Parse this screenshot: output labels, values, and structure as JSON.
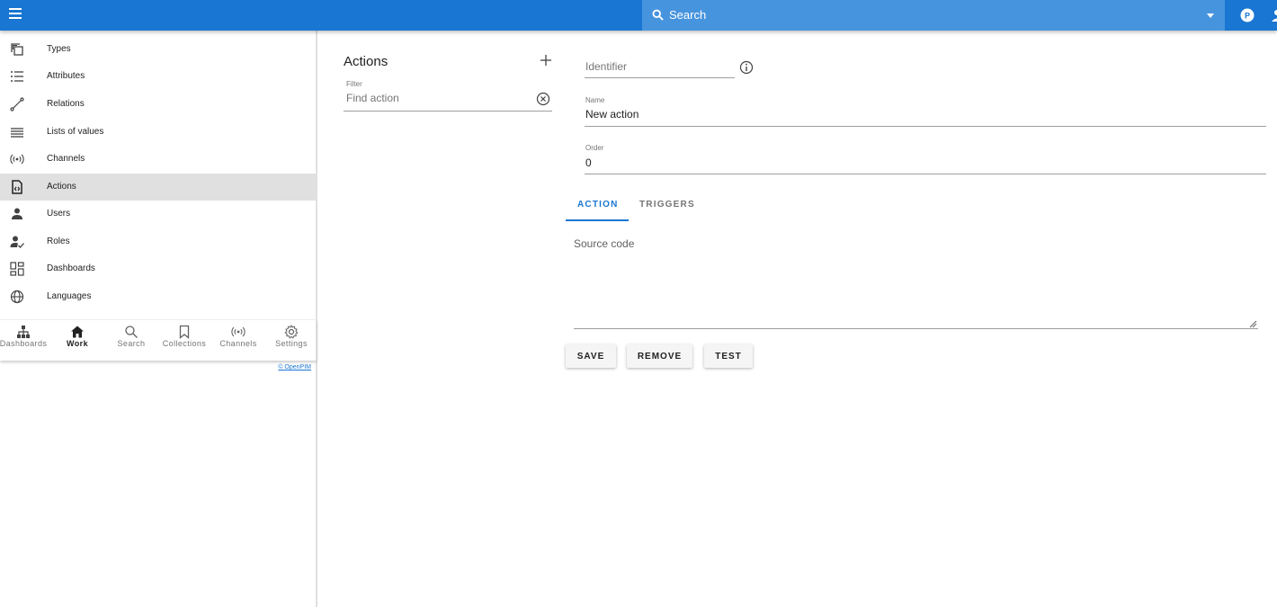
{
  "topbar": {
    "search_placeholder": "Search",
    "accent_color": "#1976d2"
  },
  "sidebar": {
    "items": [
      {
        "label": "Types",
        "icon": "types-icon"
      },
      {
        "label": "Attributes",
        "icon": "list-icon"
      },
      {
        "label": "Relations",
        "icon": "relations-icon"
      },
      {
        "label": "Lists of values",
        "icon": "lines-icon"
      },
      {
        "label": "Channels",
        "icon": "channels-icon"
      },
      {
        "label": "Actions",
        "icon": "code-file-icon",
        "active": true
      },
      {
        "label": "Users",
        "icon": "person-icon"
      },
      {
        "label": "Roles",
        "icon": "person-check-icon"
      },
      {
        "label": "Dashboards",
        "icon": "dashboard-icon"
      },
      {
        "label": "Languages",
        "icon": "globe-icon"
      }
    ],
    "bottom_nav": [
      {
        "label": "Dashboards",
        "icon": "sitemap-icon"
      },
      {
        "label": "Work",
        "icon": "home-icon",
        "active": true
      },
      {
        "label": "Search",
        "icon": "search-icon"
      },
      {
        "label": "Collections",
        "icon": "bookmark-icon"
      },
      {
        "label": "Channels",
        "icon": "channels-icon"
      },
      {
        "label": "Settings",
        "icon": "gear-icon"
      }
    ],
    "copyright": "© OpenPIM"
  },
  "list_panel": {
    "title": "Actions",
    "filter_label": "Filter",
    "filter_placeholder": "Find action"
  },
  "form": {
    "identifier_placeholder": "Identifier",
    "name_label": "Name",
    "name_value": "New action",
    "order_label": "Order",
    "order_value": "0",
    "tabs": [
      "ACTION",
      "TRIGGERS"
    ],
    "source_code_placeholder": "Source code",
    "buttons": {
      "save": "SAVE",
      "remove": "REMOVE",
      "test": "TEST"
    }
  }
}
